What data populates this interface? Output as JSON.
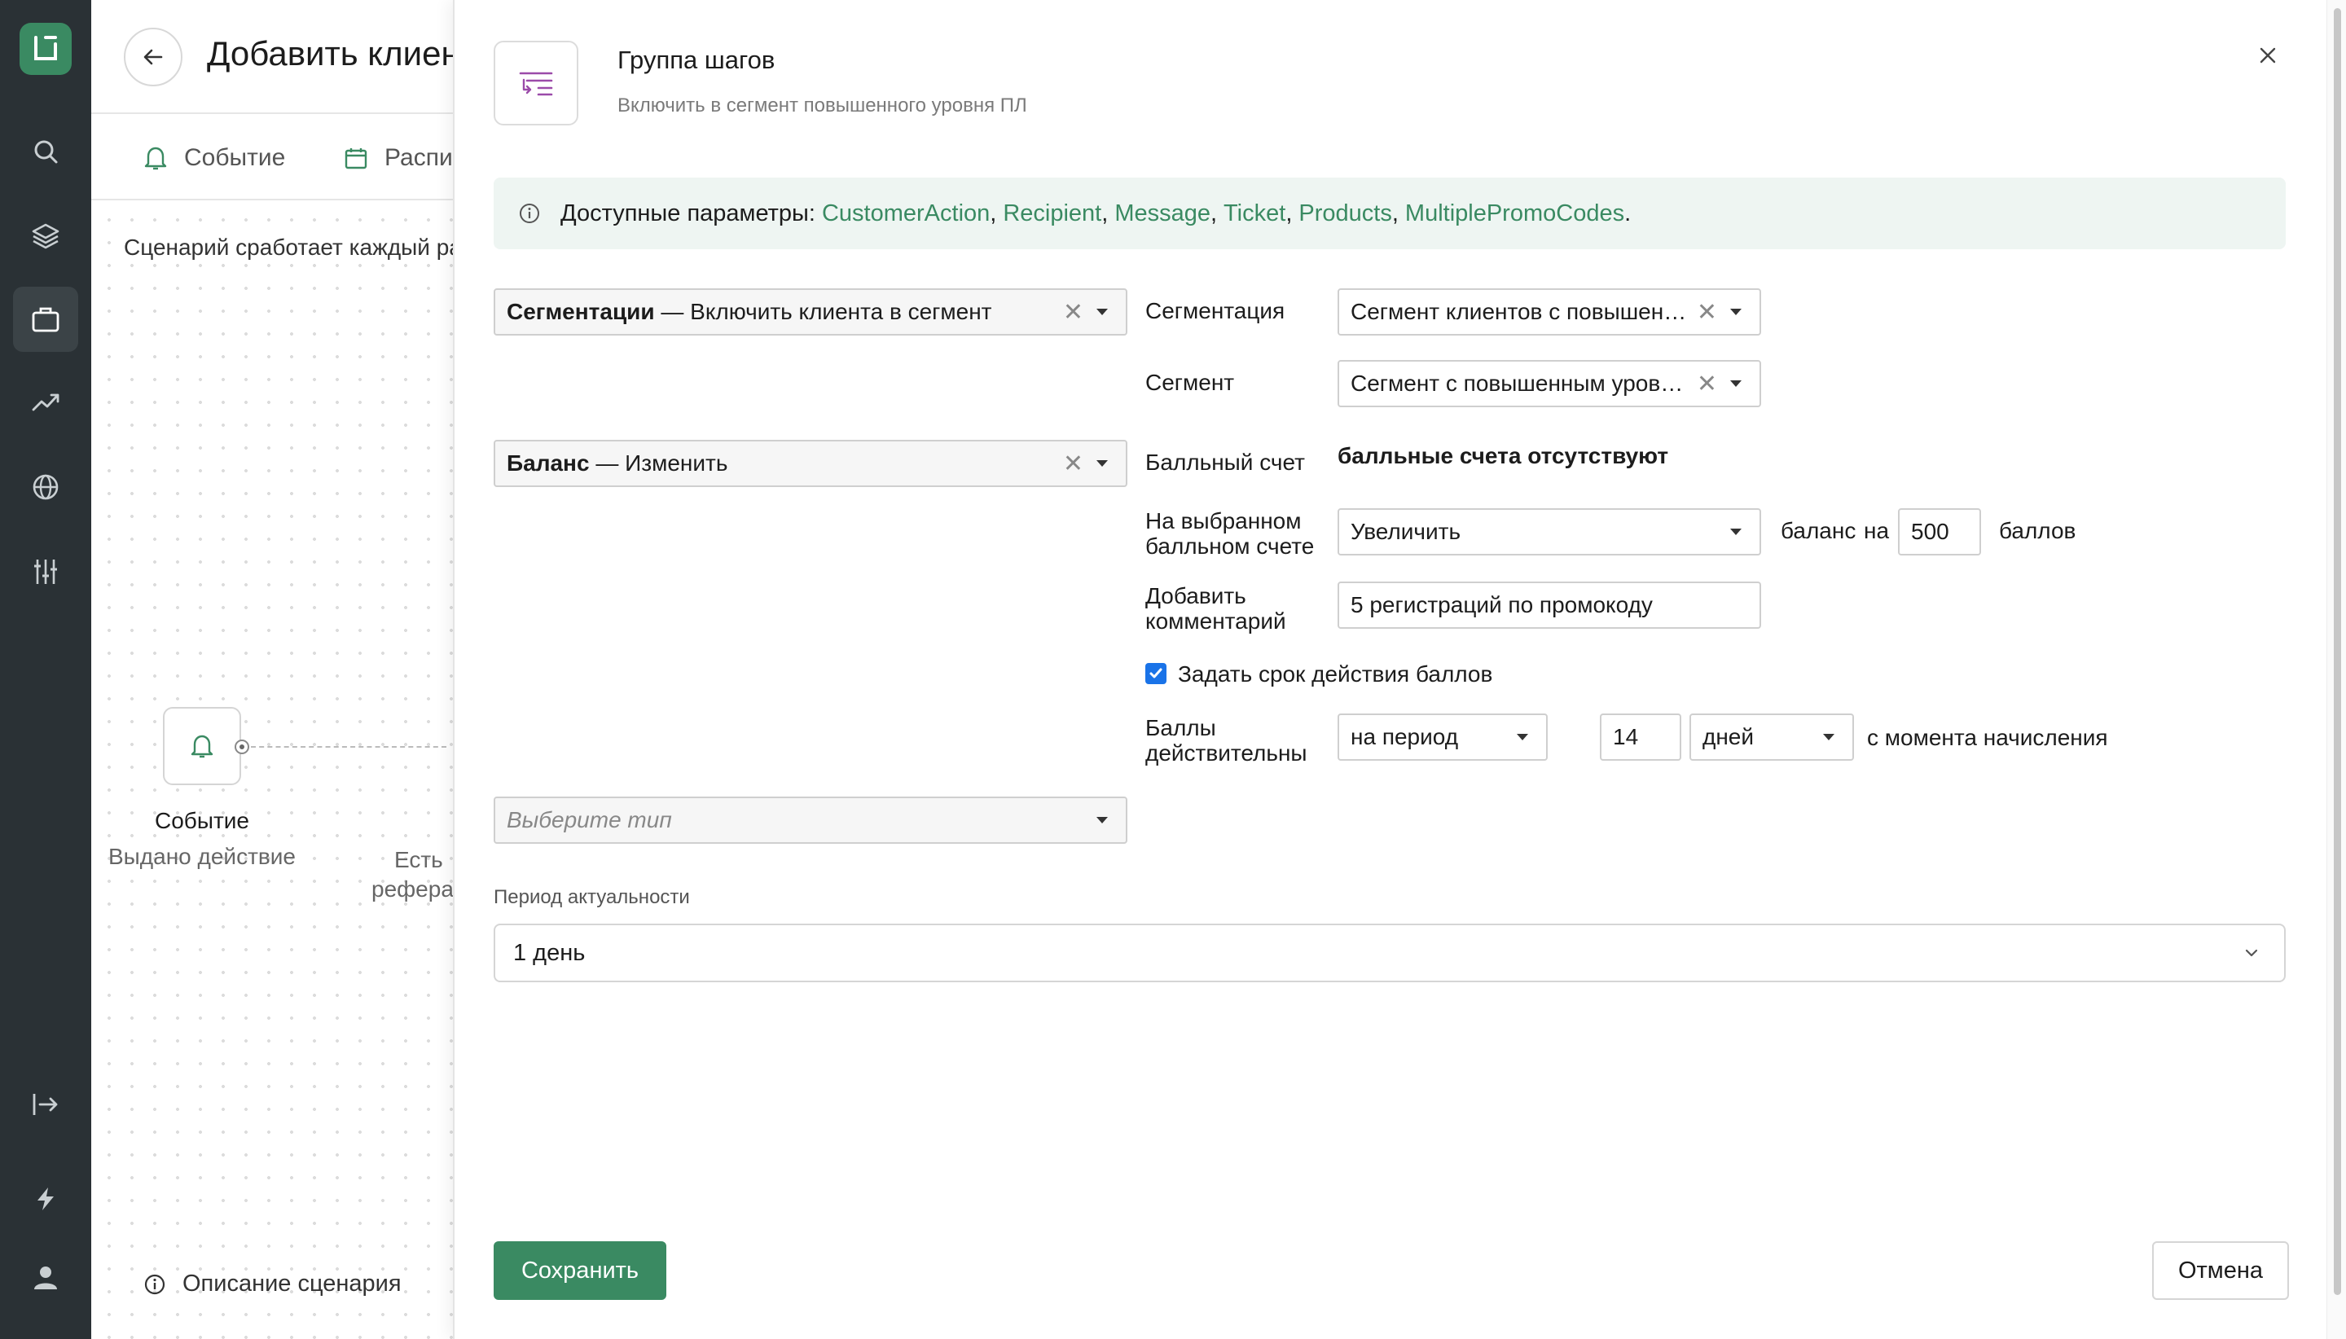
{
  "colors": {
    "accent": "#3a8a62",
    "rail_bg": "#2a3135",
    "info_bg": "#eef5f2",
    "checkbox": "#1a73e8"
  },
  "rail": {
    "logo_icon": "logo-icon",
    "items": [
      {
        "icon": "search-icon",
        "active": false
      },
      {
        "icon": "layers-icon",
        "active": false
      },
      {
        "icon": "briefcase-icon",
        "active": true
      },
      {
        "icon": "trending-up-icon",
        "active": false
      },
      {
        "icon": "globe-icon",
        "active": false
      },
      {
        "icon": "sliders-icon",
        "active": false
      }
    ],
    "bottom_items": [
      {
        "icon": "logout-icon"
      },
      {
        "icon": "lightning-icon"
      },
      {
        "icon": "user-icon"
      }
    ]
  },
  "editor": {
    "title": "Добавить клиен",
    "tabs": [
      {
        "label": "Событие",
        "icon": "bell-icon"
      },
      {
        "label": "Распи",
        "icon": "calendar-icon"
      }
    ],
    "description": "Сценарий сработает каждый ра",
    "node": {
      "title": "Событие",
      "subtitle": "Выдано действие",
      "icon": "bell-icon"
    },
    "node2_line1": "Есть",
    "node2_line2": "рефера",
    "footer_link": "Описание сценария"
  },
  "panel": {
    "title": "Группа шагов",
    "subtitle": "Включить в сегмент повышенного уровня ПЛ",
    "info": {
      "label": "Доступные параметры:",
      "params": [
        "CustomerAction",
        "Recipient",
        "Message",
        "Ticket",
        "Products",
        "MultiplePromoCodes"
      ],
      "end": "."
    },
    "step1": {
      "type_bold": "Сегментации",
      "type_rest": " — Включить клиента в сегмент",
      "segmentation_label": "Сегментация",
      "segmentation_value": "Сегмент клиентов с повышенным уровнем ПЛ",
      "segment_label": "Сегмент",
      "segment_value": "Сегмент с повышенным уровнем ПЛ"
    },
    "step2": {
      "type_bold": "Баланс",
      "type_rest": " — Изменить",
      "account_label": "Балльный счет",
      "account_value": "балльные счета отсутствуют",
      "on_account_label_1": "На выбранном",
      "on_account_label_2": "балльном счете",
      "operation_value": "Увеличить",
      "balance_text": "баланс",
      "on_text": "на",
      "amount_value": "500",
      "points_text": "баллов",
      "comment_label_1": "Добавить",
      "comment_label_2": "комментарий",
      "comment_value": "5 регистраций по промокоду",
      "expiry_checkbox_label": "Задать срок действия баллов",
      "expiry_checked": true,
      "valid_label_1": "Баллы",
      "valid_label_2": "действительны",
      "period_value": "на период",
      "period_count": "14",
      "period_unit": "дней",
      "from_text": "с момента начисления"
    },
    "step3": {
      "placeholder": "Выберите тип"
    },
    "relevance": {
      "label": "Период актуальности",
      "value": "1 день"
    },
    "save_label": "Сохранить",
    "cancel_label": "Отмена"
  }
}
